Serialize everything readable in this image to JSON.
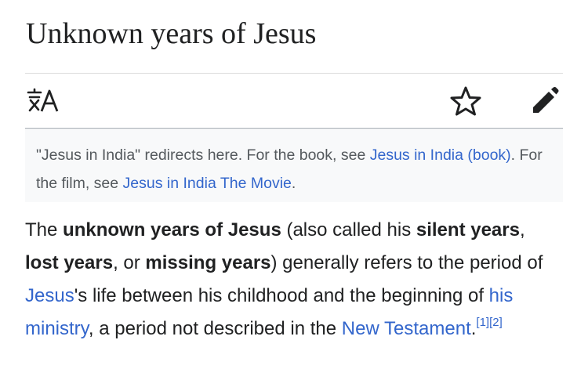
{
  "article": {
    "title": "Unknown years of Jesus"
  },
  "toolbar": {
    "language_icon": "translate-icon",
    "watch_icon": "star-icon",
    "edit_icon": "pencil-icon"
  },
  "hatnote": {
    "text1": "\"Jesus in India\" redirects here. For the book, see ",
    "link1": "Jesus in India (book)",
    "text2": ". For the film, see ",
    "link2": "Jesus in India The Movie",
    "text3": "."
  },
  "lead": {
    "t1": "The ",
    "b1": "unknown years of Jesus",
    "t2": " (also called his ",
    "b2": "silent years",
    "t3": ",",
    "b3": "lost years",
    "t4": ", or ",
    "b4": "missing years",
    "t5": ") generally refers to the period of ",
    "l1": "Jesus",
    "t6": "'s life between his childhood and the beginning of ",
    "l2": "his ministry",
    "t7": ", a period not described in the ",
    "l3": "New Testament",
    "t8": ".",
    "ref1": "[1]",
    "ref2": "[2]"
  },
  "colors": {
    "link": "#3366cc",
    "text": "#202122",
    "hatnote_bg": "#f8f9fa",
    "hatnote_text": "#54595d"
  }
}
